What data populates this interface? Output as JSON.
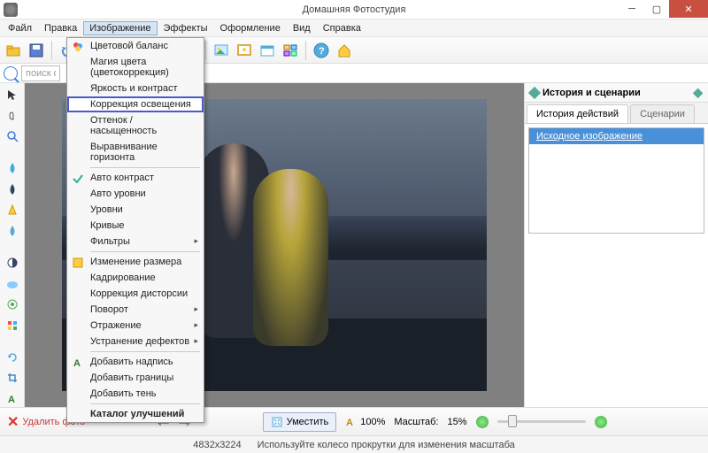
{
  "title": "Домашняя Фотостудия",
  "menu": [
    "Файл",
    "Правка",
    "Изображение",
    "Эффекты",
    "Оформление",
    "Вид",
    "Справка"
  ],
  "menu_active_index": 2,
  "search_placeholder": "поиск фу",
  "dropdown": {
    "items": [
      {
        "label": "Цветовой баланс",
        "icon": "palette"
      },
      {
        "label": "Магия цвета (цветокоррекция)"
      },
      {
        "label": "Яркость и контраст"
      },
      {
        "label": "Коррекция освещения",
        "highlight": true
      },
      {
        "label": "Оттенок / насыщенность"
      },
      {
        "label": "Выравнивание горизонта"
      },
      {
        "sep": true
      },
      {
        "label": "Авто контраст",
        "icon": "check"
      },
      {
        "label": "Авто уровни"
      },
      {
        "label": "Уровни"
      },
      {
        "label": "Кривые"
      },
      {
        "label": "Фильтры",
        "arrow": true
      },
      {
        "sep": true
      },
      {
        "label": "Изменение размера",
        "icon": "resize"
      },
      {
        "label": "Кадрирование"
      },
      {
        "label": "Коррекция дисторсии"
      },
      {
        "label": "Поворот",
        "arrow": true
      },
      {
        "label": "Отражение",
        "arrow": true
      },
      {
        "label": "Устранение дефектов",
        "arrow": true
      },
      {
        "sep": true
      },
      {
        "label": "Добавить надпись",
        "icon": "text"
      },
      {
        "label": "Добавить границы"
      },
      {
        "label": "Добавить тень"
      },
      {
        "sep": true
      },
      {
        "label": "Каталог улучшений",
        "bold": true
      }
    ]
  },
  "right_panel": {
    "title": "История и сценарии",
    "tabs": [
      "История действий",
      "Сценарии"
    ],
    "active_tab": 0,
    "history": [
      "Исходное изображение"
    ]
  },
  "bottom": {
    "delete": "Удалить фото",
    "fit": "Уместить",
    "zoom_100": "100%",
    "scale_label": "Масштаб:",
    "scale_value": "15%"
  },
  "status": {
    "dimensions": "4832x3224",
    "hint": "Используйте колесо прокрутки для изменения масштаба"
  }
}
